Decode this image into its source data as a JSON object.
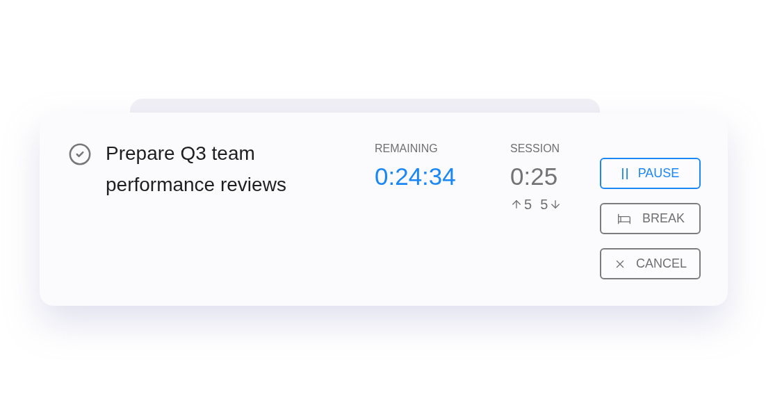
{
  "task": {
    "title": "Prepare Q3 team performance reviews"
  },
  "stats": [
    {
      "label": "REMAINING",
      "value": "0:24:34",
      "highlighted": true
    },
    {
      "label": "SESSION",
      "value": "0:25",
      "highlighted": false,
      "adjusters": [
        {
          "kind": "up",
          "value": "5"
        },
        {
          "kind": "down",
          "value": "5"
        }
      ]
    }
  ],
  "buttons": [
    {
      "kind": "pause",
      "label": "PAUSE",
      "active": true
    },
    {
      "kind": "break",
      "label": "BREAK",
      "active": false
    },
    {
      "kind": "cancel",
      "label": "CANCEL",
      "active": false
    }
  ]
}
